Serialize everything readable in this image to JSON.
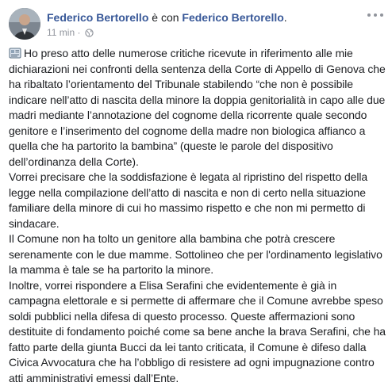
{
  "post": {
    "author": "Federico Bertorello",
    "with_text": "è con",
    "tagged": "Federico Bertorello",
    "tagged_suffix": ".",
    "timestamp": "11 min",
    "separator": "·",
    "privacy_icon": "globe-icon",
    "emoji_icon": "newspaper-emoji-icon",
    "more_icon": "more-options-icon",
    "paragraphs": [
      "Ho preso atto delle numerose critiche ricevute in riferimento alle mie dichiarazioni nei confronti della sentenza della Corte di Appello di Genova che ha ribaltato l’orientamento del Tribunale stabilendo “che non è possibile indicare nell’atto di nascita della minore la doppia genitorialità in capo alle due madri mediante l’annotazione del cognome della ricorrente quale secondo genitore e l’inserimento del cognome della madre non biologica affianco a quella che ha partorito la bambina” (queste le parole del dispositivo dell’ordinanza della Corte).",
      "Vorrei precisare che la soddisfazione è legata al ripristino del rispetto della legge nella compilazione dell’atto di nascita e non di certo nella situazione familiare della minore di cui ho massimo rispetto e che non mi permetto di sindacare.",
      "Il Comune non ha tolto un genitore alla bambina che potrà crescere serenamente con le due mamme. Sottolineo che per l'ordinamento legislativo la mamma è tale se ha partorito la minore.",
      "Inoltre, vorrei rispondere a Elisa Serafini che evidentemente è già in campagna elettorale e si permette di affermare che il Comune avrebbe speso soldi pubblici nella difesa di questo processo. Queste affermazioni sono destituite di fondamento poiché come sa bene anche la brava Serafini, che ha fatto parte della giunta Bucci da lei tanto criticata, il Comune è difeso dalla Civica Avvocatura che ha l’obbligo di resistere ad ogni impugnazione contro atti amministrativi emessi dall’Ente."
    ]
  }
}
